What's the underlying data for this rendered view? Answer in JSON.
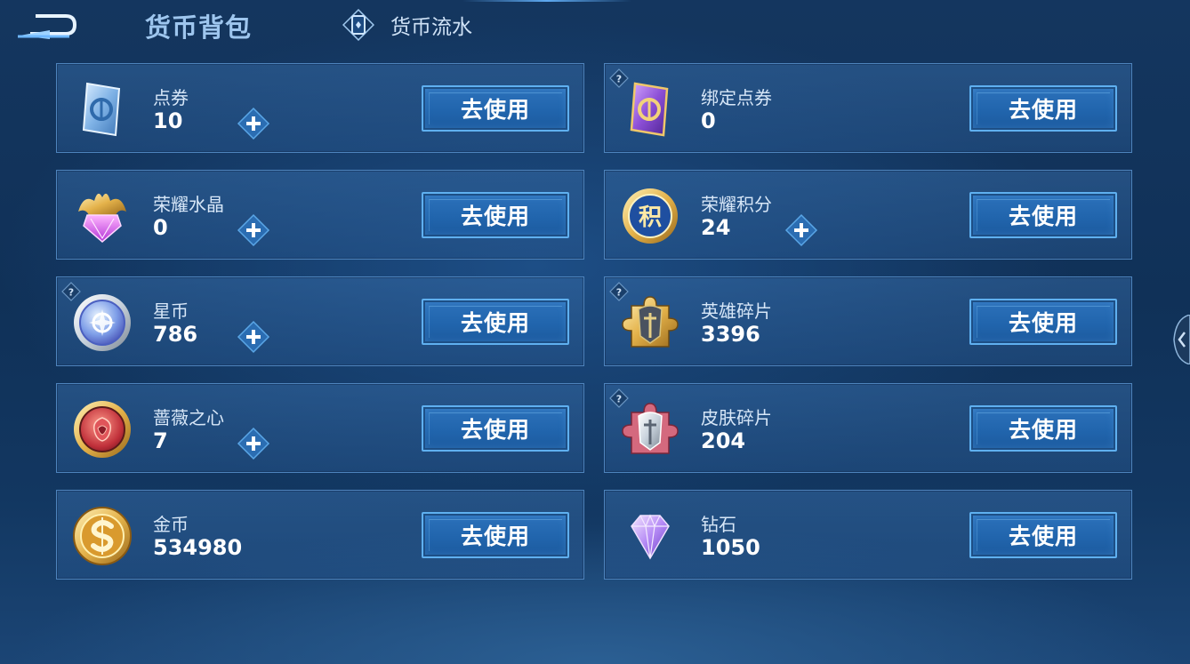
{
  "header": {
    "title": "货币背包",
    "flow_tab_label": "货币流水"
  },
  "currencies": [
    {
      "name": "点券",
      "amount": "10",
      "button": "去使用",
      "icon": "voucher-blue-icon"
    },
    {
      "name": "绑定点券",
      "amount": "0",
      "button": "去使用",
      "icon": "voucher-purple-icon"
    },
    {
      "name": "荣耀水晶",
      "amount": "0",
      "button": "去使用",
      "icon": "glory-crystal-icon"
    },
    {
      "name": "荣耀积分",
      "amount": "24",
      "button": "去使用",
      "icon": "glory-points-icon",
      "badge_glyph": "积"
    },
    {
      "name": "星币",
      "amount": "786",
      "button": "去使用",
      "icon": "star-coin-icon"
    },
    {
      "name": "英雄碎片",
      "amount": "3396",
      "button": "去使用",
      "icon": "hero-fragment-icon"
    },
    {
      "name": "蔷薇之心",
      "amount": "7",
      "button": "去使用",
      "icon": "rose-heart-icon"
    },
    {
      "name": "皮肤碎片",
      "amount": "204",
      "button": "去使用",
      "icon": "skin-fragment-icon"
    },
    {
      "name": "金币",
      "amount": "534980",
      "button": "去使用",
      "icon": "gold-coin-icon"
    },
    {
      "name": "钻石",
      "amount": "1050",
      "button": "去使用",
      "icon": "diamond-icon"
    }
  ],
  "colors": {
    "button_fill": "#2468b0",
    "button_border": "#5fb0f0",
    "card_border": "#4e84bd",
    "title": "#9ec6ee"
  }
}
